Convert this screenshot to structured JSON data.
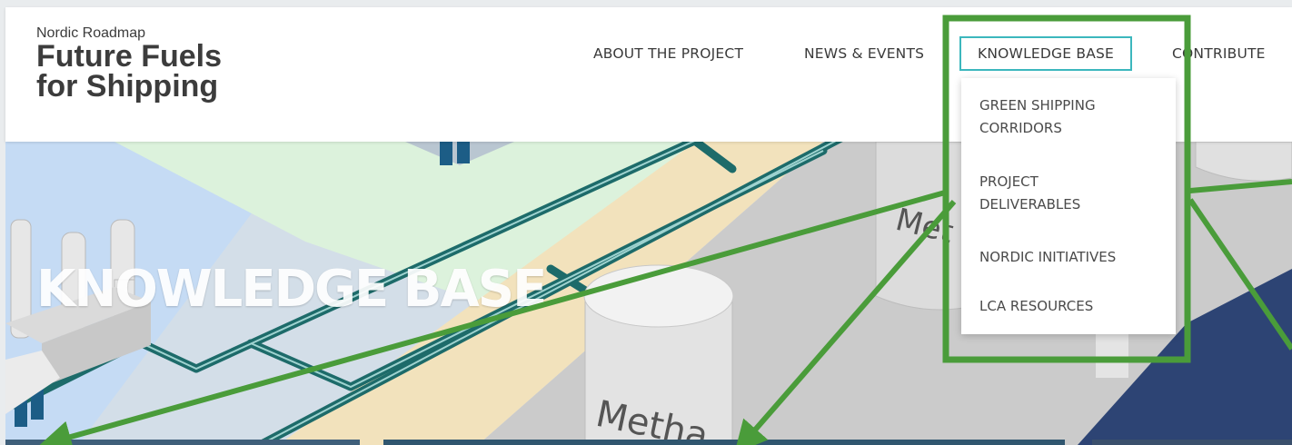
{
  "logo": {
    "small": "Nordic Roadmap",
    "line1": "Future Fuels",
    "line2": "for Shipping"
  },
  "nav": {
    "about": "ABOUT THE PROJECT",
    "news": "NEWS & EVENTS",
    "knowledge": "KNOWLEDGE BASE",
    "contribute": "CONTRIBUTE"
  },
  "dropdown": {
    "item1_line1": "GREEN SHIPPING",
    "item1_line2": "CORRIDORS",
    "item2_line1": "PROJECT",
    "item2_line2": "DELIVERABLES",
    "item3": "NORDIC INITIATIVES",
    "item4": "LCA RESOURCES"
  },
  "hero": {
    "title": "KNOWLEDGE BASE",
    "tank_label_1": "Met",
    "tank_label_2": "Metha"
  },
  "colors": {
    "accent": "#3cb7bd",
    "annotation": "#4a9c3a",
    "pipe": "#1d6b6a"
  }
}
